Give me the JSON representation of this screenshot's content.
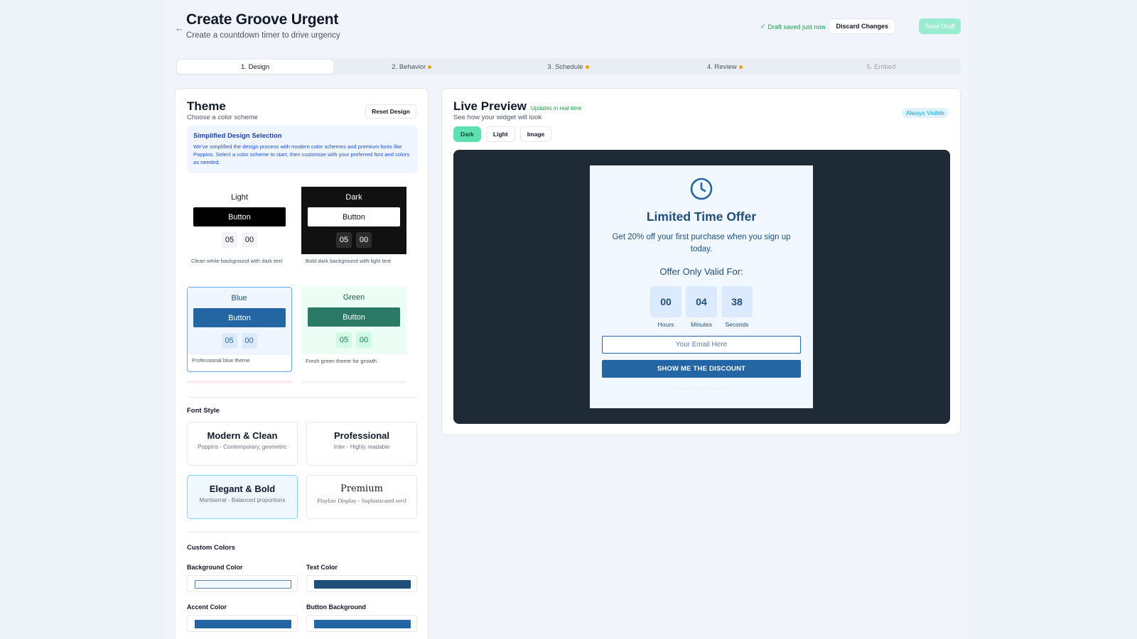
{
  "header": {
    "title": "Create Groove Urgent",
    "subtitle": "Create a countdown timer to drive urgency",
    "draft_status": "Draft saved just now",
    "discard_label": "Discard Changes",
    "save_label": "Save Draft"
  },
  "steps": [
    {
      "label": "1. Design",
      "state": "active"
    },
    {
      "label": "2. Behavior",
      "state": "pending"
    },
    {
      "label": "3. Schedule",
      "state": "pending"
    },
    {
      "label": "4. Review",
      "state": "pending"
    },
    {
      "label": "5. Embed",
      "state": "disabled"
    }
  ],
  "theme": {
    "title": "Theme",
    "subtitle": "Choose a color scheme",
    "reset_label": "Reset Design",
    "info_title": "Simplified Design Selection",
    "info_text": "We've simplified the design process with modern color schemes and premium fonts like Poppins. Select a color scheme to start, then customize with your preferred font and colors as needed.",
    "cards": [
      {
        "name": "Light",
        "button": "Button",
        "digits": [
          "05",
          "00"
        ],
        "description": "Clean white background with dark text"
      },
      {
        "name": "Dark",
        "button": "Button",
        "digits": [
          "05",
          "00"
        ],
        "description": "Bold dark background with light text"
      },
      {
        "name": "Blue",
        "button": "Button",
        "digits": [
          "05",
          "00"
        ],
        "description": "Professional blue theme"
      },
      {
        "name": "Green",
        "button": "Button",
        "digits": [
          "05",
          "00"
        ],
        "description": "Fresh green theme for growth"
      }
    ]
  },
  "fonts": {
    "label": "Font Style",
    "options": [
      {
        "name": "Modern & Clean",
        "description": "Poppins - Contemporary, geometric"
      },
      {
        "name": "Professional",
        "description": "Inter - Highly readable"
      },
      {
        "name": "Elegant & Bold",
        "description": "Montserrat - Balanced proportions"
      },
      {
        "name": "Premium",
        "description": "Playfair Display - Sophisticated serif"
      }
    ]
  },
  "colors": {
    "label": "Custom Colors",
    "background_label": "Background Color",
    "background_value": "#f1f8ff",
    "text_label": "Text Color",
    "text_value": "#1e4e79",
    "accent_label": "Accent Color",
    "accent_value": "#2466a4",
    "button_bg_label": "Button Background",
    "button_bg_value": "#2466a4"
  },
  "preview": {
    "title": "Live Preview",
    "live_note": "Updates in real-time",
    "subtitle": "See how your widget will look",
    "visibility_badge": "Always Visible",
    "modes": [
      "Dark",
      "Light",
      "Image"
    ],
    "widget": {
      "heading": "Limited Time Offer",
      "text": "Get 20% off your first purchase when you sign up today.",
      "valid_label": "Offer Only Valid For:",
      "timer": [
        {
          "value": "00",
          "label": "Hours"
        },
        {
          "value": "04",
          "label": "Minutes"
        },
        {
          "value": "38",
          "label": "Seconds"
        }
      ],
      "email_placeholder": "Your Email Here",
      "cta_label": "SHOW ME THE DISCOUNT",
      "powered_by": "Powered by GrooveJar"
    }
  },
  "accent_colors": {
    "brand_green": "#5ee0b0",
    "brand_blue": "#2466a4",
    "stage_dark": "#1f2a37",
    "pending_dot": "#f59e0b"
  }
}
